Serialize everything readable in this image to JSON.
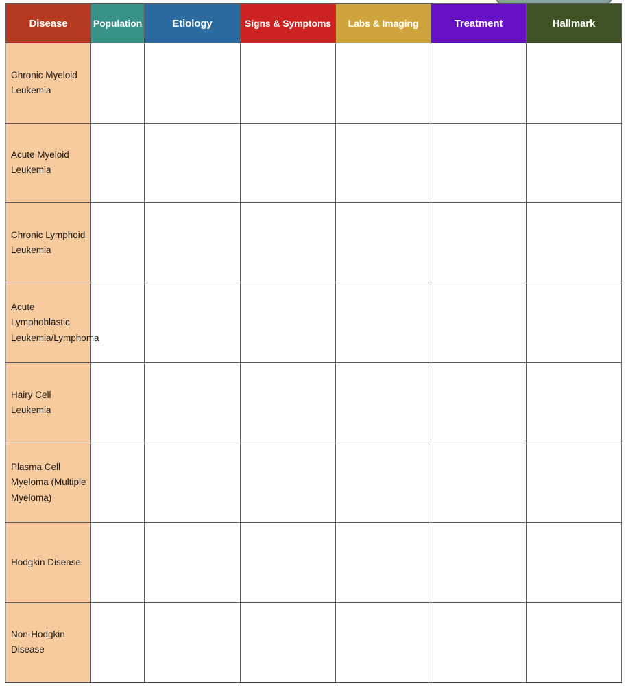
{
  "table": {
    "columns": [
      {
        "label": "Disease",
        "color": "#b4391f",
        "name": "disease"
      },
      {
        "label": "Population",
        "color": "#389187",
        "name": "population"
      },
      {
        "label": "Etiology",
        "color": "#2a6a9e",
        "name": "etiology"
      },
      {
        "label": "Signs & Symptoms",
        "color": "#cc2222",
        "name": "signs-symptoms"
      },
      {
        "label": "Labs & Imaging",
        "color": "#cfa43c",
        "name": "labs-imaging"
      },
      {
        "label": "Treatment",
        "color": "#6610c4",
        "name": "treatment"
      },
      {
        "label": "Hallmark",
        "color": "#3f5226",
        "name": "hallmark"
      }
    ],
    "rows": [
      {
        "disease": "Chronic Myeloid Leukemia",
        "population": "",
        "etiology": "",
        "signs_symptoms": "",
        "labs_imaging": "",
        "treatment": "",
        "hallmark": ""
      },
      {
        "disease": "Acute Myeloid Leukemia",
        "population": "",
        "etiology": "",
        "signs_symptoms": "",
        "labs_imaging": "",
        "treatment": "",
        "hallmark": ""
      },
      {
        "disease": "Chronic Lymphoid Leukemia",
        "population": "",
        "etiology": "",
        "signs_symptoms": "",
        "labs_imaging": "",
        "treatment": "",
        "hallmark": ""
      },
      {
        "disease": "Acute Lymphoblastic Leukemia/Lymphoma",
        "population": "",
        "etiology": "",
        "signs_symptoms": "",
        "labs_imaging": "",
        "treatment": "",
        "hallmark": ""
      },
      {
        "disease": "Hairy Cell Leukemia",
        "population": "",
        "etiology": "",
        "signs_symptoms": "",
        "labs_imaging": "",
        "treatment": "",
        "hallmark": ""
      },
      {
        "disease": "Plasma Cell Myeloma (Multiple Myeloma)",
        "population": "",
        "etiology": "",
        "signs_symptoms": "",
        "labs_imaging": "",
        "treatment": "",
        "hallmark": ""
      },
      {
        "disease": "Hodgkin Disease",
        "population": "",
        "etiology": "",
        "signs_symptoms": "",
        "labs_imaging": "",
        "treatment": "",
        "hallmark": ""
      },
      {
        "disease": "Non-Hodgkin Disease",
        "population": "",
        "etiology": "",
        "signs_symptoms": "",
        "labs_imaging": "",
        "treatment": "",
        "hallmark": ""
      }
    ]
  },
  "colors": {
    "row_label_fill": "#f7cb9e",
    "cell_fill": "#ffffff",
    "grid_line": "#5a5a5a",
    "header_text": "#ffffff"
  },
  "top_widget": {
    "fill": "#87a39f",
    "border": "#5f7d79"
  }
}
